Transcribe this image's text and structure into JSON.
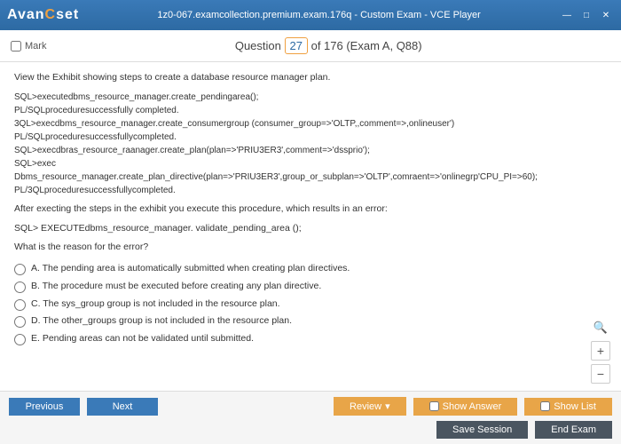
{
  "titlebar": {
    "logo_prefix": "Avan",
    "logo_o": "☉",
    "logo_suffix": "set",
    "title": "1z0-067.examcollection.premium.exam.176q - Custom Exam - VCE Player"
  },
  "header": {
    "mark_label": "Mark",
    "question_label": "Question",
    "question_number": "27",
    "question_total": " of 176 (Exam A, Q88)"
  },
  "content": {
    "intro": "View the Exhibit showing steps to create a database resource manager plan.",
    "code": [
      "SQL>executedbms_resource_manager.create_pendingarea();",
      "PL/SQLproceduresuccessfully completed.",
      "3QL>execdbms_resource_manager.create_consumergroup (consumer_group=>'OLTP,,comment=>,onlineuser')",
      "PL/SQLproceduresuccessfullycompleted.",
      "SQL>execdbras_resource_raanager.create_plan(plan=>'PRIU3ER3',comment=>'dssprio');",
      "SQL>exec",
      "Dbms_resource_manager.create_plan_directive(plan=>'PRIU3ER3',group_or_subplan=>'OLTP',comraent=>'onlinegrp'CPU_PI=>60);",
      "PL/3QLproceduresuccessfullycompleted."
    ],
    "after": "After execting the steps in the exhibit you execute this procedure, which results in an error:",
    "exec_line": "SQL> EXECUTEdbms_resource_manager. validate_pending_area ();",
    "question": "What is the reason for the error?",
    "options": [
      "A.  The pending area is automatically submitted when creating plan directives.",
      "B.  The procedure must be executed before creating any plan directive.",
      "C.  The sys_group group is not included in the resource plan.",
      "D.  The other_groups group is not included in the resource plan.",
      "E.  Pending areas can not be validated until submitted."
    ]
  },
  "footer": {
    "previous": "Previous",
    "next": "Next",
    "review": "Review",
    "show_answer": "Show Answer",
    "show_list": "Show List",
    "save_session": "Save Session",
    "end_exam": "End Exam"
  }
}
